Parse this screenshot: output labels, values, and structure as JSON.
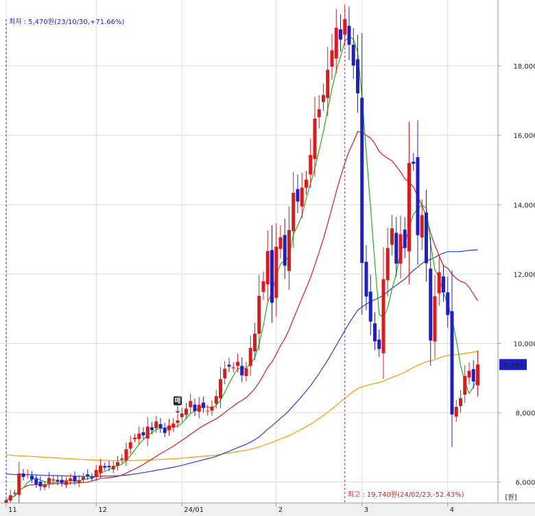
{
  "chart_data": {
    "type": "candlestick",
    "yticks": [
      6000,
      8000,
      10000,
      12000,
      14000,
      16000,
      18000
    ],
    "ytick_labels": [
      "6,000",
      "8,000",
      "10,000",
      "12,000",
      "14,000",
      "16,000",
      "18,000"
    ],
    "ylim": [
      5400,
      19900
    ],
    "y_unit": "[원]",
    "x_ticks": [
      {
        "label": "11",
        "index": 0
      },
      {
        "label": "12",
        "index": 21
      },
      {
        "label": "24/01",
        "index": 41
      },
      {
        "label": "2",
        "index": 63
      },
      {
        "label": "3",
        "index": 83
      },
      {
        "label": "4",
        "index": 103
      }
    ],
    "current_price": 9390,
    "current_price_label": "9,390",
    "low_annotation": "최저 : 5,470원(23/10/30,+71.66%)",
    "high_annotation": "최고 : 19,740원(24/02/23,-52.43%)",
    "low_index": 0,
    "high_index": 79,
    "buy_marker": {
      "label": "매",
      "index": 40
    },
    "closes": [
      5480,
      5620,
      5690,
      6250,
      6150,
      6230,
      6080,
      5940,
      5880,
      5930,
      6120,
      6080,
      6020,
      5980,
      6030,
      6110,
      6020,
      6060,
      6150,
      6180,
      6120,
      6350,
      6480,
      6420,
      6430,
      6470,
      6580,
      6680,
      6950,
      7150,
      7280,
      7400,
      7350,
      7600,
      7500,
      7750,
      7560,
      7420,
      7630,
      7690,
      7780,
      7980,
      8120,
      8340,
      8050,
      8230,
      8140,
      8060,
      8180,
      8480,
      8970,
      9270,
      9330,
      9310,
      9470,
      9080,
      9280,
      9870,
      10280,
      11370,
      11790,
      12660,
      11170,
      12790,
      13060,
      12240,
      13270,
      14340,
      14090,
      14490,
      14720,
      15430,
      16480,
      16750,
      17160,
      17890,
      18450,
      19100,
      18760,
      19350,
      18610,
      18010,
      17210,
      12320,
      11350,
      10630,
      10060,
      9840,
      11850,
      12750,
      13320,
      12300,
      13150,
      12750,
      15200,
      15180,
      13120,
      13700,
      12310,
      10080,
      11360,
      12050,
      11470,
      10820,
      7950,
      8170,
      8420,
      9060,
      9210,
      8900,
      9390
    ],
    "colors": {
      "up": "#e01818",
      "down": "#1f1fc8",
      "ma5": "#1ab51a",
      "ma20": "#e01818",
      "ma60": "#1f3ee0",
      "ma120": "#ff9900",
      "current_badge": "#1f1fc8",
      "annotation_low": "#1f1fc8",
      "annotation_high": "#e01818"
    }
  }
}
